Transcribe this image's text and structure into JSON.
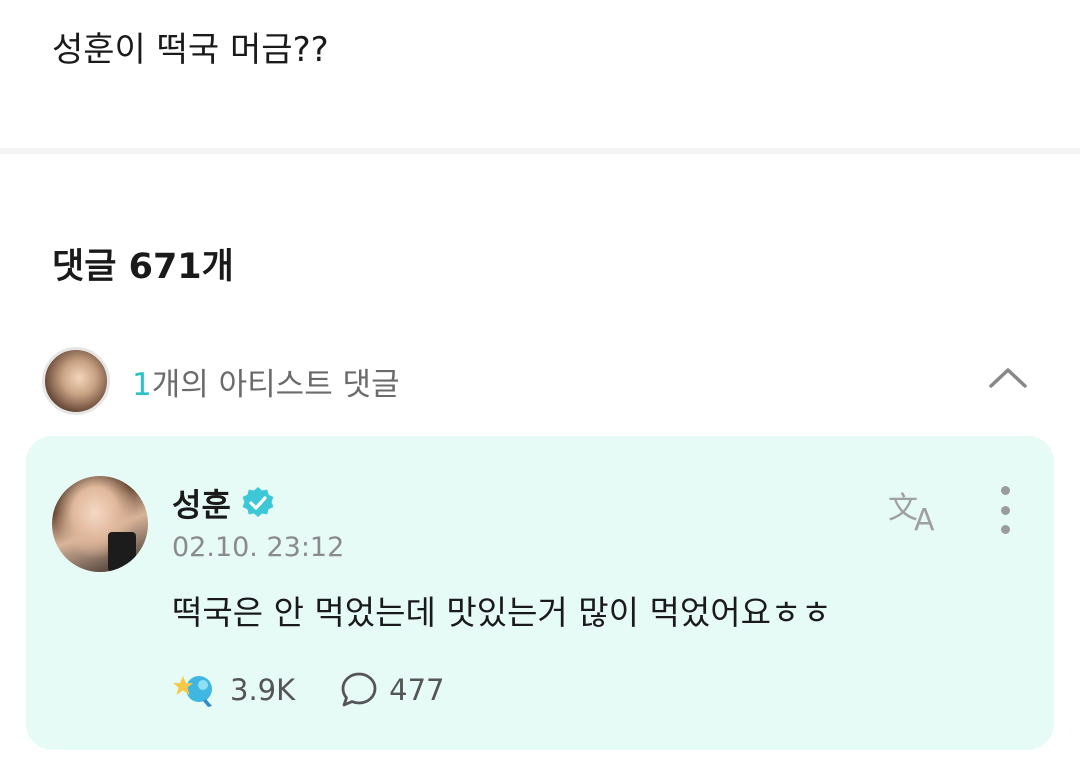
{
  "post": {
    "text": "성훈이 떡국 머금??"
  },
  "comments_header": {
    "title": "댓글 671개"
  },
  "artist_comments": {
    "count": "1",
    "label_suffix": "개의 아티스트 댓글",
    "toggle_icon": "chevron-up-icon"
  },
  "comment": {
    "username": "성훈",
    "verified_icon": "verified-badge-icon",
    "timestamp": "02.10. 23:12",
    "body": "떡국은 안 먹었는데 맛있는거 많이 먹었어요ㅎㅎ",
    "likes": "3.9K",
    "replies": "477",
    "translate_icon": "translate-icon",
    "more_icon": "more-vertical-icon",
    "card_color": "#e6fbf6",
    "accent_color": "#2cc2c4"
  }
}
